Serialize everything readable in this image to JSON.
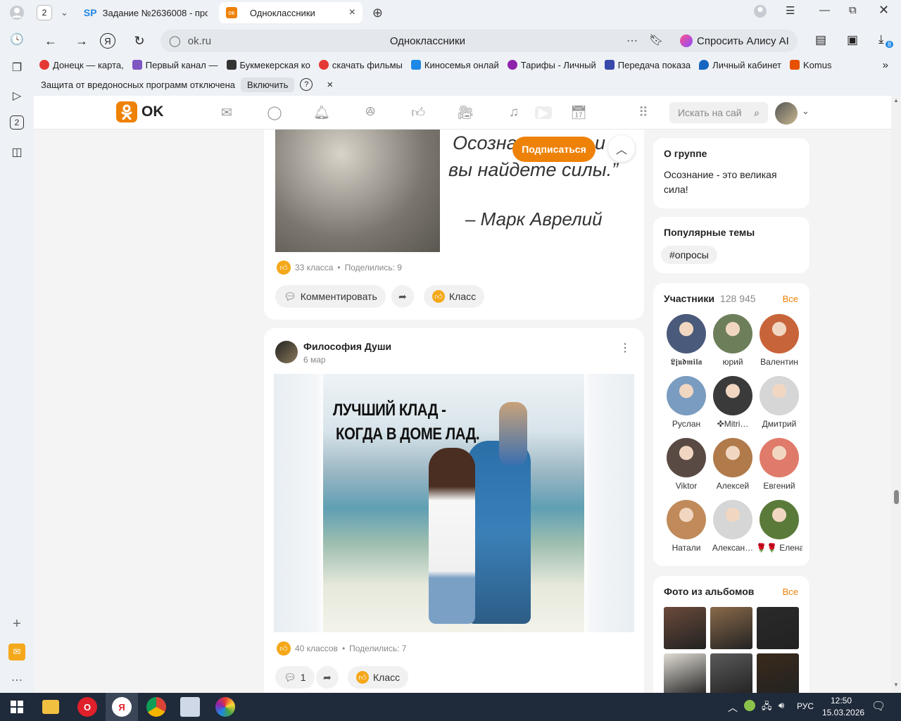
{
  "browser": {
    "tab_count": "2",
    "tabs": [
      {
        "favicon": "SP",
        "title": "Задание №2636008 - про"
      },
      {
        "favicon": "OK",
        "title": "Одноклассники"
      }
    ],
    "url": "ok.ru",
    "page_title": "Одноклассники",
    "alisa_label": "Спросить Алису AI",
    "downloads_badge": "8",
    "bookmarks": [
      {
        "label": "Донецк — карта,",
        "color": "#e53935"
      },
      {
        "label": "Первый канал —",
        "color": "#7e57c2"
      },
      {
        "label": "Букмекерская ко",
        "color": "#333333"
      },
      {
        "label": "скачать фильмы",
        "color": "#e53935"
      },
      {
        "label": "Киносемья онлай",
        "color": "#1e88e5"
      },
      {
        "label": "Тарифы - Личный",
        "color": "#8e24aa"
      },
      {
        "label": "Передача показа",
        "color": "#3949ab"
      },
      {
        "label": "Личный кабинет",
        "color": "#1565c0"
      },
      {
        "label": "Komus",
        "color": "#e65100"
      }
    ],
    "infobar": {
      "text": "Защита от вредоносных программ отключена",
      "button": "Включить",
      "help": "?",
      "close": "×"
    }
  },
  "ok": {
    "logo_text": "OK",
    "search_placeholder": "Искать на сай"
  },
  "post1": {
    "quote_line1": "Осознан",
    "quote_line1_end": "и",
    "quote_line2": "вы найдете силы.”",
    "quote_author": "– Марк Аврелий",
    "likes": "33 класса",
    "shares": "Поделились: 9",
    "comment_btn": "Комментировать",
    "klass_btn": "Класс"
  },
  "subscribe_btn": "Подписаться",
  "post2": {
    "author": "Философия Души",
    "date": "6 мар",
    "image_text_line1": "ЛУЧШИЙ КЛАД -",
    "image_text_line2": "КОГДА В ДОМЕ ЛАД.",
    "likes": "40 классов",
    "shares": "Поделились: 7",
    "comments": "1",
    "klass_btn": "Класс"
  },
  "sidebar": {
    "about_title": "О группе",
    "about_text": "Осознание - это великая сила!",
    "topics_title": "Популярные темы",
    "topic": "#опросы",
    "members_title": "Участники",
    "members_count": "128 945",
    "all_link": "Все",
    "members": [
      {
        "name": "𝕷𝖏𝖚𝖉𝖒𝖎𝖑𝖆",
        "color": "#4a5a7a"
      },
      {
        "name": "юрий",
        "color": "#6d7f5a"
      },
      {
        "name": "Валентин",
        "color": "#c8643a"
      },
      {
        "name": "Руслан",
        "color": "#7a9cc0"
      },
      {
        "name": "✜Mitri…",
        "color": "#3a3a3a"
      },
      {
        "name": "Дмитрий",
        "color": "#d6d6d6"
      },
      {
        "name": "Viktor",
        "color": "#5a4a44"
      },
      {
        "name": "Алексей",
        "color": "#b07a4a"
      },
      {
        "name": "Евгений",
        "color": "#e07a6a"
      },
      {
        "name": "Натали",
        "color": "#c08a5a"
      },
      {
        "name": "Алексан…",
        "color": "#d6d6d6"
      },
      {
        "name": "🌹🌹 Елена",
        "color": "#5a7a3a"
      }
    ],
    "photos_title": "Фото из альбомов",
    "photos_all": "Все",
    "photos": [
      "#6a4a3a",
      "#8a6a4a",
      "#2a2a2a",
      "#e0dcd4",
      "#5a5a5a",
      "#3a2a1a"
    ]
  },
  "taskbar": {
    "lang": "РУС",
    "time": "12:50",
    "date": "15.03.2026"
  }
}
